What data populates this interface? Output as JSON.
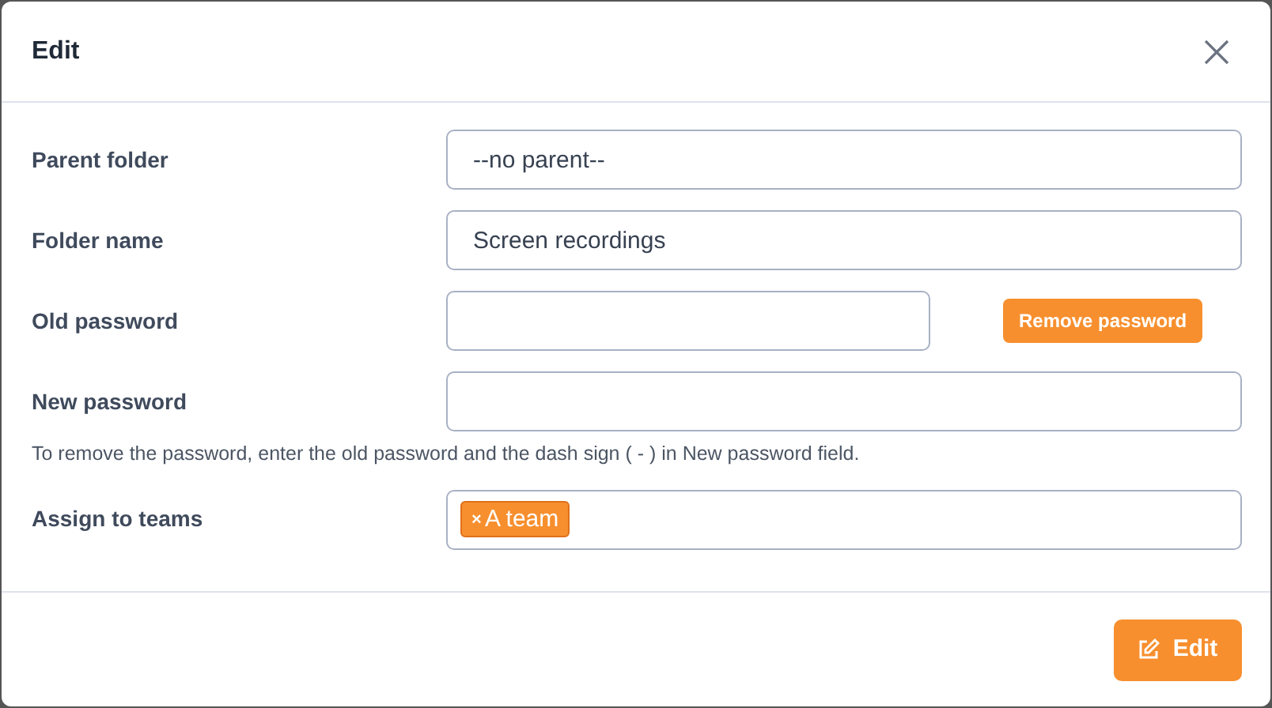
{
  "dialog": {
    "title": "Edit"
  },
  "fields": [
    {
      "kind": "text",
      "label": "Parent folder",
      "value": "--no parent--"
    },
    {
      "kind": "text",
      "label": "Folder name",
      "value": "Screen recordings"
    },
    {
      "kind": "password",
      "label": "Old password",
      "button": "Remove password"
    },
    {
      "kind": "password",
      "label": "New password",
      "hint": "To remove the password, enter the old password and the dash sign ( - ) in New password field."
    },
    {
      "kind": "tags",
      "label": "Assign to teams",
      "tags": [
        {
          "remove": "×",
          "label": "A team"
        }
      ]
    }
  ],
  "submit": {
    "label": "Edit"
  }
}
